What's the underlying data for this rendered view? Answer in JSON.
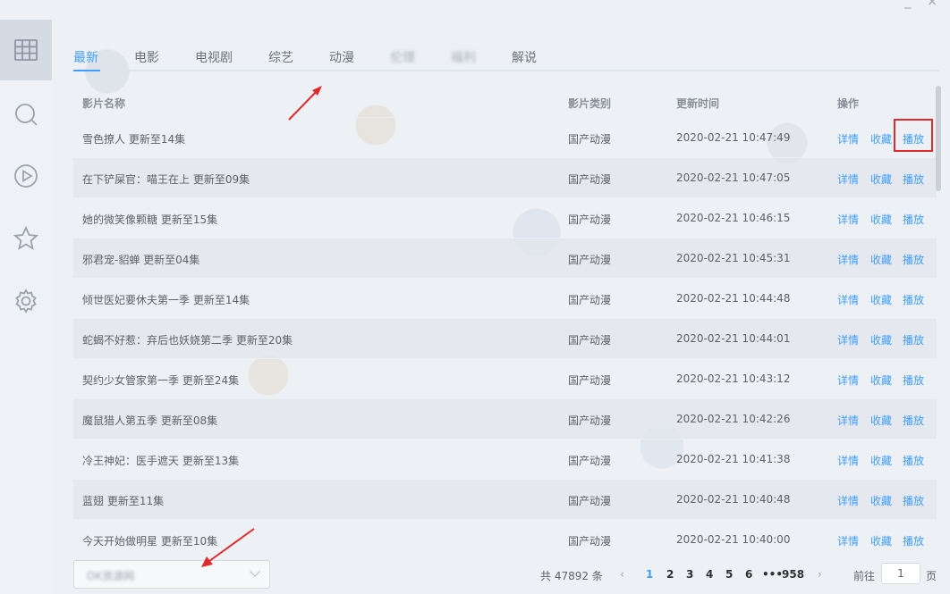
{
  "tabs": [
    {
      "label": "最新",
      "active": true
    },
    {
      "label": "电影"
    },
    {
      "label": "电视剧"
    },
    {
      "label": "综艺"
    },
    {
      "label": "动漫"
    },
    {
      "label": "伦理",
      "blurred": true
    },
    {
      "label": "福利",
      "blurred": true
    },
    {
      "label": "解说"
    }
  ],
  "table": {
    "headers": {
      "name": "影片名称",
      "type": "影片类别",
      "time": "更新时间",
      "ops": "操作"
    },
    "rows": [
      {
        "name": "雪色撩人 更新至14集",
        "type": "国产动漫",
        "time": "2020-02-21 10:47:49"
      },
      {
        "name": "在下铲屎官：喵王在上 更新至09集",
        "type": "国产动漫",
        "time": "2020-02-21 10:47:05"
      },
      {
        "name": "她的微笑像颗糖 更新至15集",
        "type": "国产动漫",
        "time": "2020-02-21 10:46:15"
      },
      {
        "name": "邪君宠-貂蝉 更新至04集",
        "type": "国产动漫",
        "time": "2020-02-21 10:45:31"
      },
      {
        "name": "倾世医妃要休夫第一季 更新至14集",
        "type": "国产动漫",
        "time": "2020-02-21 10:44:48"
      },
      {
        "name": "蛇蝎不好惹：弃后也妖娆第二季 更新至20集",
        "type": "国产动漫",
        "time": "2020-02-21 10:44:01"
      },
      {
        "name": "契约少女管家第一季 更新至24集",
        "type": "国产动漫",
        "time": "2020-02-21 10:43:12"
      },
      {
        "name": "魔鼠猎人第五季 更新至08集",
        "type": "国产动漫",
        "time": "2020-02-21 10:42:26"
      },
      {
        "name": "冷王神妃：医手遮天 更新至13集",
        "type": "国产动漫",
        "time": "2020-02-21 10:41:38"
      },
      {
        "name": "蓝翅 更新至11集",
        "type": "国产动漫",
        "time": "2020-02-21 10:40:48"
      },
      {
        "name": "今天开始做明星 更新至10集",
        "type": "国产动漫",
        "time": "2020-02-21 10:40:00"
      }
    ],
    "actions": {
      "detail": "详情",
      "favorite": "收藏",
      "play": "播放"
    }
  },
  "source_select": {
    "value": "OK资源网"
  },
  "pagination": {
    "total": "共 47892 条",
    "prev": "‹",
    "pages": [
      "1",
      "2",
      "3",
      "4",
      "5",
      "6"
    ],
    "ellipsis": "•••",
    "last": "958",
    "next": "›",
    "goto_label": "前往",
    "goto_value": "1",
    "goto_unit": "页",
    "current": "1"
  },
  "colors": {
    "accent": "#409eff",
    "highlight": "#e02a2a"
  },
  "icons": [
    "grid-icon",
    "search-icon",
    "play-circle-icon",
    "star-icon",
    "gear-icon"
  ]
}
